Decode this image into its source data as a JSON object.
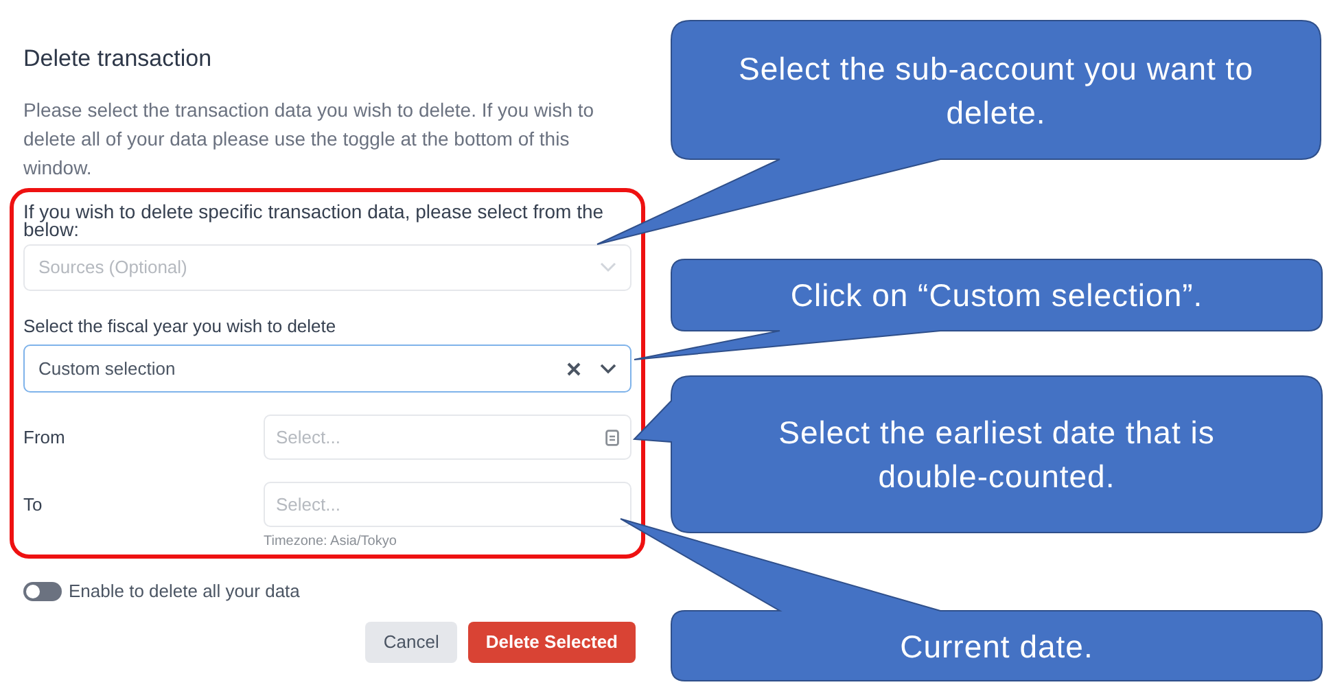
{
  "dialog": {
    "title": "Delete transaction",
    "description": "Please select the transaction data you wish to delete. If you wish to delete all of your data please use the toggle at the bottom of this window.",
    "sources_label": "If you wish to delete specific transaction data, please select from the below:",
    "sources_select": {
      "placeholder": "Sources (Optional)"
    },
    "fiscal_year": {
      "label": "Select the fiscal year you wish to delete",
      "value": "Custom selection"
    },
    "date_fields": [
      {
        "label": "From",
        "placeholder": "Select...",
        "has_icon": true
      },
      {
        "label": "To",
        "placeholder": "Select...",
        "has_icon": false
      }
    ],
    "timezone": "Timezone: Asia/Tokyo",
    "toggle": {
      "label": "Enable to delete all your data",
      "on": false
    },
    "buttons": [
      {
        "label": "Cancel",
        "kind": "secondary"
      },
      {
        "label": "Delete Selected",
        "kind": "danger"
      }
    ]
  },
  "callouts": [
    {
      "text": "Select the sub-account you want to delete."
    },
    {
      "text": "Click on “Custom selection”."
    },
    {
      "text": "Select the earliest date that is double-counted."
    },
    {
      "text": "Current date."
    }
  ]
}
